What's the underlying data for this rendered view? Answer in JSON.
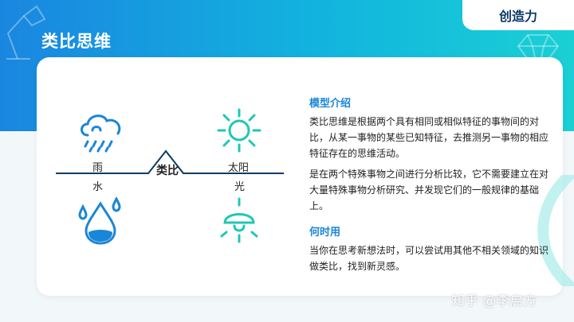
{
  "title": "类比思维",
  "tag": "创造力",
  "diagram": {
    "center": "类比",
    "left_top": "雨",
    "left_bottom": "水",
    "right_top": "太阳",
    "right_bottom": "光"
  },
  "model": {
    "heading": "模型介绍",
    "p1": "类比思维是根据两个具有相同或相似特征的事物间的对比，从某一事物的某些已知特征，去推测另一事物的相应特征存在的思维活动。",
    "p2": "是在两个特殊事物之间进行分析比较，它不需要建立在对大量特殊事物分析研究、并发现它们的一般规律的基础上。"
  },
  "when": {
    "heading": "何时用",
    "p1": "当你在思考新想法时，可以尝试用其他不相关领域的知识做类比，找到新灵感。"
  },
  "watermark": "知乎 @李启方",
  "colors": {
    "accent": "#1a86d8",
    "teal": "#1ec8b4",
    "navy": "#0b3a66"
  }
}
